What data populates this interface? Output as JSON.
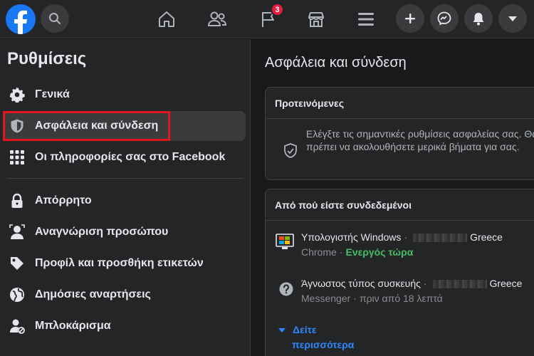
{
  "topbar": {
    "notifications_badge": "3",
    "icons": [
      "facebook-logo",
      "search-icon",
      "home-icon",
      "friends-icon",
      "pages-flag-icon",
      "marketplace-icon",
      "menu-icon",
      "create-plus-icon",
      "messenger-icon",
      "notifications-bell-icon",
      "account-caret-icon"
    ]
  },
  "sidebar": {
    "title": "Ρυθμίσεις",
    "items": [
      {
        "label": "Γενικά",
        "icon": "gear-icon"
      },
      {
        "label": "Ασφάλεια και σύνδεση",
        "icon": "shield-icon",
        "active": true
      },
      {
        "label": "Οι πληροφορίες σας στο Facebook",
        "icon": "grid-icon"
      },
      {
        "label": "Απόρρητο",
        "icon": "lock-icon"
      },
      {
        "label": "Αναγνώριση προσώπου",
        "icon": "face-recognition-icon"
      },
      {
        "label": "Προφίλ και προσθήκη ετικετών",
        "icon": "tag-icon"
      },
      {
        "label": "Δημόσιες αναρτήσεις",
        "icon": "globe-icon"
      },
      {
        "label": "Μπλοκάρισμα",
        "icon": "block-user-icon"
      }
    ]
  },
  "main": {
    "title": "Ασφάλεια και σύνδεση",
    "recommended": {
      "header": "Προτεινόμενες",
      "text": "Ελέγξτε τις σημαντικές ρυθμίσεις ασφαλείας σας. Θα πρέπει να ακολουθήσετε μερικά βήματα για σας."
    },
    "logged_in": {
      "header": "Από πού είστε συνδεδεμένοι",
      "devices": [
        {
          "name": "Υπολογιστής Windows",
          "location": "Greece",
          "app": "Chrome",
          "status": "Ενεργός τώρα",
          "icon": "windows-computer-icon"
        },
        {
          "name": "Άγνωστος τύπος συσκευής",
          "location": "Greece",
          "app": "Messenger",
          "status": "πριν από 18 λεπτά",
          "icon": "unknown-device-icon"
        }
      ],
      "see_more_1": "Δείτε",
      "see_more_2": "περισσότερα"
    }
  },
  "colors": {
    "accent": "#1877f2",
    "link": "#2d88ff",
    "active_green": "#45bd62",
    "badge_red": "#e41e3f",
    "highlight_red": "#e3141e"
  }
}
